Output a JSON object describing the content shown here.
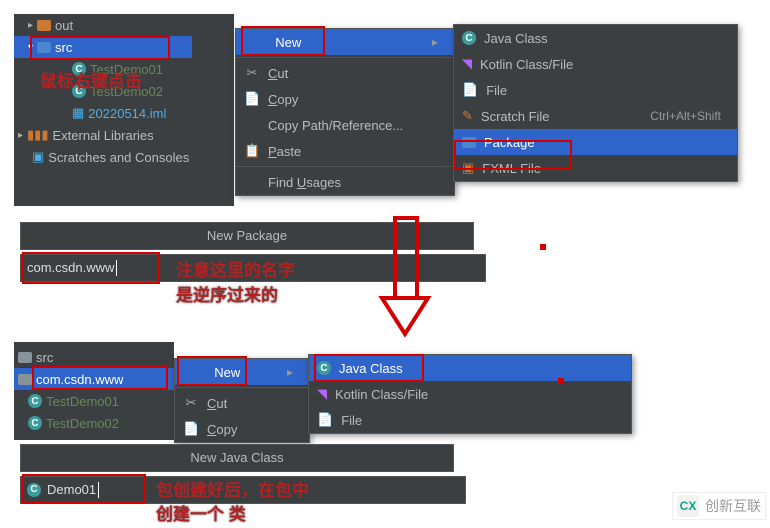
{
  "tree1": {
    "items": [
      "out",
      "src",
      "TestDemo01",
      "TestDemo02",
      "20220514.iml",
      "External Libraries",
      "Scratches and Consoles"
    ]
  },
  "ctx1": {
    "items": [
      {
        "label": "New",
        "highlight": true
      },
      {
        "label": "Cut",
        "icon": "✂",
        "key": "X"
      },
      {
        "label": "Copy",
        "icon": "📄",
        "key": "C"
      },
      {
        "label": "Copy Path/Reference..."
      },
      {
        "label": "Paste",
        "icon": "📋",
        "key": "P"
      },
      {
        "label": "Find Usages",
        "key": "U"
      }
    ]
  },
  "newmenu1": {
    "items": [
      {
        "label": "Java Class",
        "icon": "c"
      },
      {
        "label": "Kotlin Class/File",
        "icon": "k"
      },
      {
        "label": "File",
        "icon": "f"
      },
      {
        "label": "Scratch File",
        "icon": "s",
        "shortcut": "Ctrl+Alt+Shift"
      },
      {
        "label": "Package",
        "icon": "p",
        "highlight": true
      },
      {
        "label": "FXML File",
        "icon": "x"
      }
    ]
  },
  "newpkg": {
    "title": "New Package",
    "value": "com.csdn.www"
  },
  "tree2": {
    "items": [
      "src",
      "com.csdn.www",
      "TestDemo01",
      "TestDemo02"
    ]
  },
  "ctx2": {
    "items": [
      {
        "label": "New",
        "highlight": true
      },
      {
        "label": "Cut",
        "icon": "✂",
        "key": "X"
      },
      {
        "label": "Copy",
        "icon": "📄",
        "key": "C"
      }
    ]
  },
  "newmenu2": {
    "items": [
      {
        "label": "Java Class",
        "icon": "c",
        "highlight": true
      },
      {
        "label": "Kotlin Class/File",
        "icon": "k"
      },
      {
        "label": "File",
        "icon": "f"
      }
    ]
  },
  "newclass": {
    "title": "New Java Class",
    "value": "Demo01"
  },
  "annot": {
    "a1": "鼠标右键点击",
    "a2a": "注意这里的名字",
    "a2b": "是逆序过来的",
    "a3a": "包创建好后，在包中",
    "a3b": "创建一个 类"
  },
  "watermark": "创新互联"
}
